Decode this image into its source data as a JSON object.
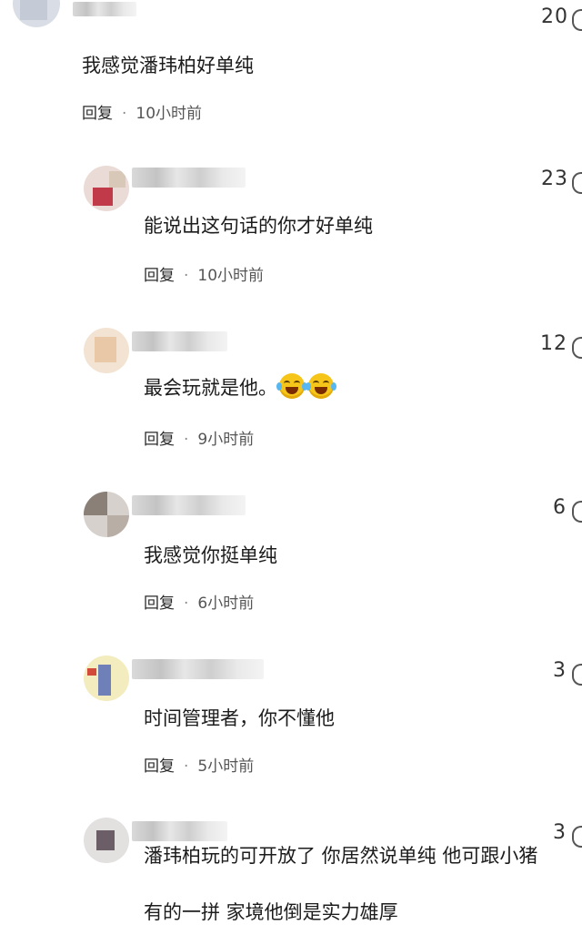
{
  "comments": [
    {
      "likes": "20",
      "text": "我感觉潘玮柏好单纯",
      "reply": "回复",
      "dot": "·",
      "time": "10小时前"
    },
    {
      "likes": "23",
      "text": "能说出这句话的你才好单纯",
      "reply": "回复",
      "dot": "·",
      "time": "10小时前"
    },
    {
      "likes": "12",
      "text": "最会玩就是他。",
      "emoji": [
        "laughing-tears-emoji",
        "laughing-tears-emoji"
      ],
      "reply": "回复",
      "dot": "·",
      "time": "9小时前"
    },
    {
      "likes": "6",
      "text": "我感觉你挺单纯",
      "reply": "回复",
      "dot": "·",
      "time": "6小时前"
    },
    {
      "likes": "3",
      "text": "时间管理者，你不懂他",
      "reply": "回复",
      "dot": "·",
      "time": "5小时前"
    },
    {
      "likes": "3",
      "text": "潘玮柏玩的可开放了 你居然说单纯 他可跟小猪",
      "text_line2": "有的一拼 家境他倒是实力雄厚"
    }
  ],
  "colors": {
    "background": "#ffffff",
    "text": "#1c1c1c",
    "meta": "#555555",
    "emoji": "#f6c51a"
  },
  "icons": {
    "like": "like-icon",
    "emoji": "laughing-tears-emoji"
  }
}
